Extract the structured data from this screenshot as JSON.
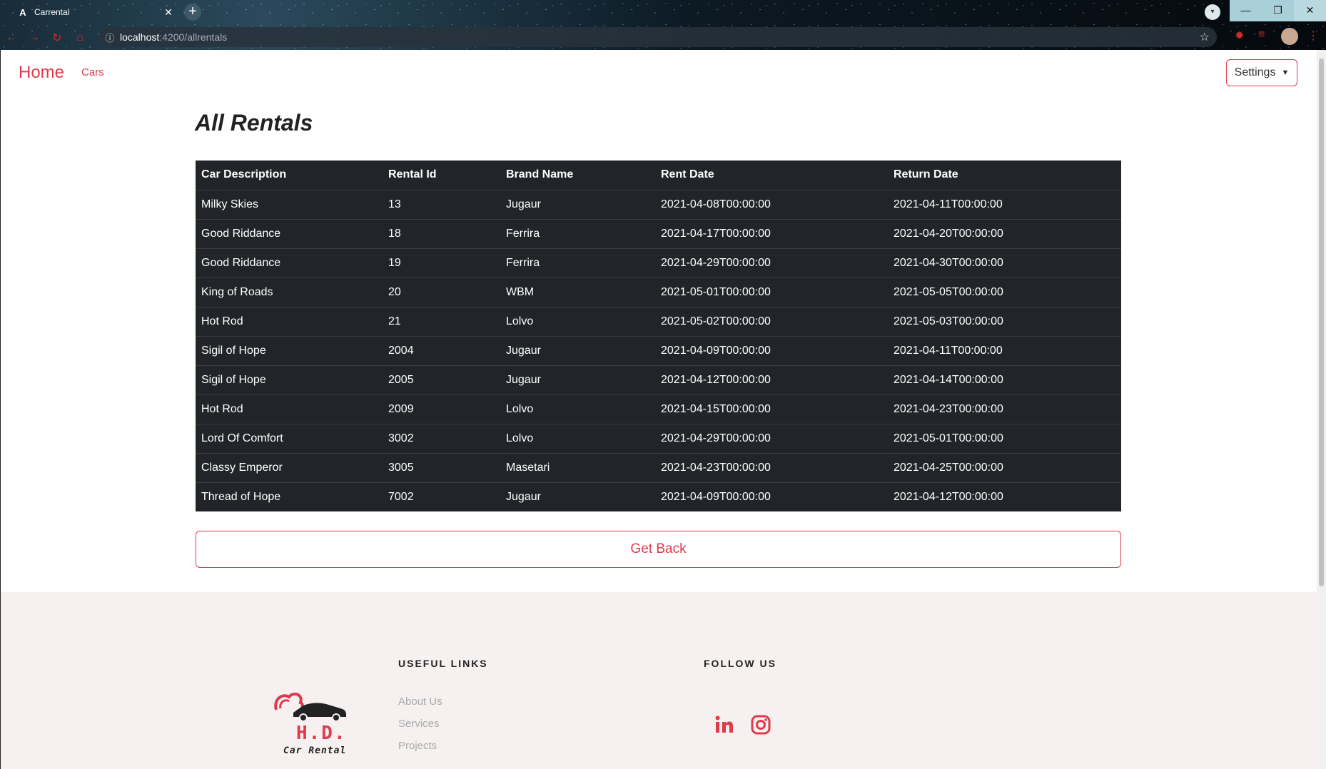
{
  "browser": {
    "tab_title": "Carrental",
    "tab_favicon": "A",
    "url_host": "localhost",
    "url_path": ":4200/allrentals"
  },
  "nav": {
    "home": "Home",
    "cars": "Cars",
    "settings": "Settings"
  },
  "page": {
    "heading": "All Rentals",
    "get_back": "Get Back"
  },
  "table": {
    "headers": [
      "Car Description",
      "Rental Id",
      "Brand Name",
      "Rent Date",
      "Return Date"
    ],
    "rows": [
      [
        "Milky Skies",
        "13",
        "Jugaur",
        "2021-04-08T00:00:00",
        "2021-04-11T00:00:00"
      ],
      [
        "Good Riddance",
        "18",
        "Ferrira",
        "2021-04-17T00:00:00",
        "2021-04-20T00:00:00"
      ],
      [
        "Good Riddance",
        "19",
        "Ferrira",
        "2021-04-29T00:00:00",
        "2021-04-30T00:00:00"
      ],
      [
        "King of Roads",
        "20",
        "WBM",
        "2021-05-01T00:00:00",
        "2021-05-05T00:00:00"
      ],
      [
        "Hot Rod",
        "21",
        "Lolvo",
        "2021-05-02T00:00:00",
        "2021-05-03T00:00:00"
      ],
      [
        "Sigil of Hope",
        "2004",
        "Jugaur",
        "2021-04-09T00:00:00",
        "2021-04-11T00:00:00"
      ],
      [
        "Sigil of Hope",
        "2005",
        "Jugaur",
        "2021-04-12T00:00:00",
        "2021-04-14T00:00:00"
      ],
      [
        "Hot Rod",
        "2009",
        "Lolvo",
        "2021-04-15T00:00:00",
        "2021-04-23T00:00:00"
      ],
      [
        "Lord Of Comfort",
        "3002",
        "Lolvo",
        "2021-04-29T00:00:00",
        "2021-05-01T00:00:00"
      ],
      [
        "Classy Emperor",
        "3005",
        "Masetari",
        "2021-04-23T00:00:00",
        "2021-04-25T00:00:00"
      ],
      [
        "Thread of Hope",
        "7002",
        "Jugaur",
        "2021-04-09T00:00:00",
        "2021-04-12T00:00:00"
      ]
    ]
  },
  "footer": {
    "logo_brand": "H.D.",
    "logo_sub": "Car Rental",
    "useful_links_title": "USEFUL LINKS",
    "links": [
      "About Us",
      "Services",
      "Projects"
    ],
    "follow_title": "FOLLOW US",
    "social_icons": [
      "linkedin-icon",
      "instagram-icon"
    ]
  },
  "colors": {
    "accent": "#e03a4a",
    "table_bg": "#212529",
    "footer_bg": "#f6f0f0"
  }
}
